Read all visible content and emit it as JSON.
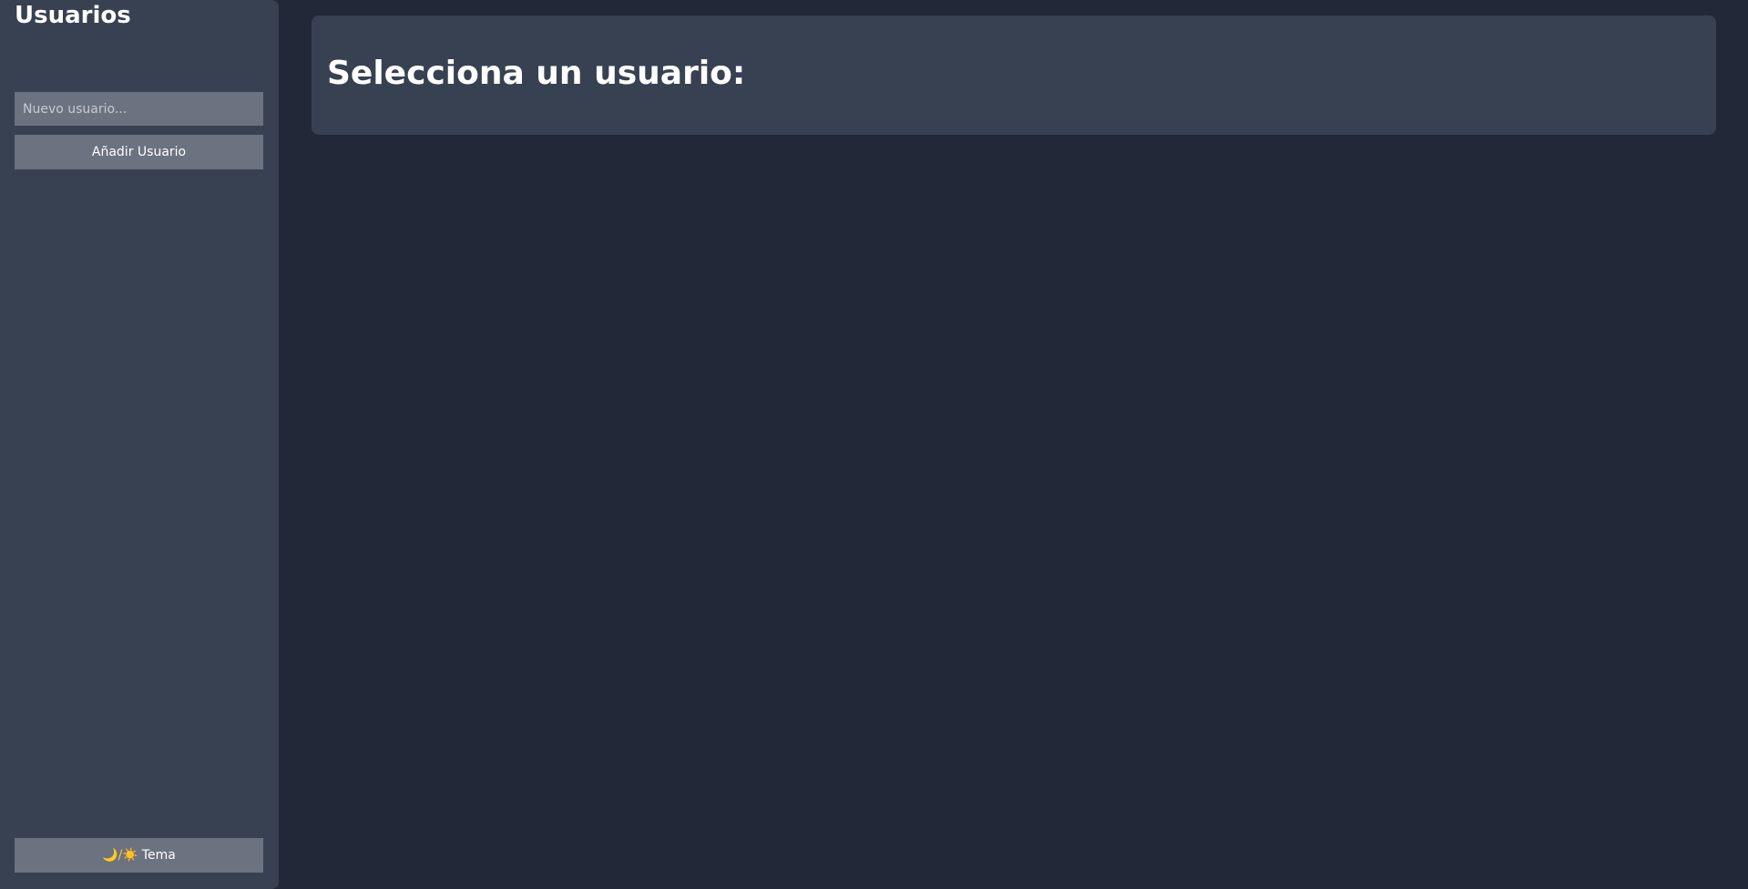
{
  "sidebar": {
    "title": "Usuarios",
    "new_user_input": {
      "placeholder": "Nuevo usuario...",
      "value": ""
    },
    "add_user_label": "Añadir Usuario",
    "theme_button": {
      "icon": "🌙/☀️",
      "label": "Tema"
    }
  },
  "main": {
    "title": "Selecciona un usuario:"
  },
  "colors": {
    "background": "#212938",
    "panel": "#384152",
    "control": "#6b7280",
    "text": "#ffffff"
  }
}
